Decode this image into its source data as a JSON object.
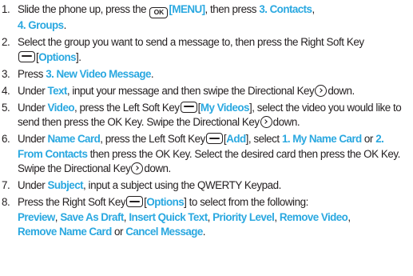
{
  "steps": [
    {
      "num": "1.",
      "t1": "Slide the phone up, press the ",
      "key1": "OK",
      "k1": "[MENU]",
      "t2": ", then press ",
      "k2": "3. Contacts",
      "t3": ",",
      "k3": "4. Groups",
      "t4": "."
    },
    {
      "num": "2.",
      "t1": "Select the group you want to send a message to, then press the Right Soft Key",
      "t2": "[",
      "k1": "Options",
      "t3": "]."
    },
    {
      "num": "3.",
      "t1": "Press ",
      "k1": "3. New Video Message",
      "t2": "."
    },
    {
      "num": "4.",
      "t1": "Under ",
      "k1": "Text",
      "t2": ", input your message and then swipe the Directional Key",
      "t3": "down."
    },
    {
      "num": "5.",
      "t1": "Under ",
      "k1": "Video",
      "t2": ", press the Left Soft Key",
      "t3": "[",
      "k2": "My Videos",
      "t4": "], select the video you would like to send then press the OK Key. Swipe the Directional Key",
      "t5": "down."
    },
    {
      "num": "6.",
      "t1": "Under ",
      "k1": "Name Card",
      "t2": ", press the Left Soft Key",
      "t3": "[",
      "k2": "Add",
      "t4": "], select ",
      "k3": "1. My Name Card",
      "t5": " or ",
      "k4": "2. From Contacts",
      "t6": " then press the OK Key. Select the desired card then press the OK Key. Swipe the Directional Key",
      "t7": "down."
    },
    {
      "num": "7.",
      "t1": "Under ",
      "k1": "Subject",
      "t2": ", input a subject using the QWERTY Keypad."
    },
    {
      "num": "8.",
      "t1": "Press the Right Soft Key",
      "t2": "[",
      "k1": "Options",
      "t3": "] to select from the following:",
      "k2": "Preview",
      "t4": ", ",
      "k3": "Save As Draft",
      "t5": ", ",
      "k4": "Insert Quick Text",
      "t6": ", ",
      "k5": "Priority Level",
      "t7": ", ",
      "k6": "Remove Video",
      "t8": ",",
      "k7": "Remove Name Card",
      "t9": " or ",
      "k8": "Cancel Message",
      "t10": "."
    }
  ],
  "icons": {
    "ok_key": "ok-key-icon",
    "soft_key": "soft-key-icon",
    "directional_key": "directional-key-icon"
  },
  "colors": {
    "text": "#231f20",
    "highlight": "#2aa8e0"
  }
}
